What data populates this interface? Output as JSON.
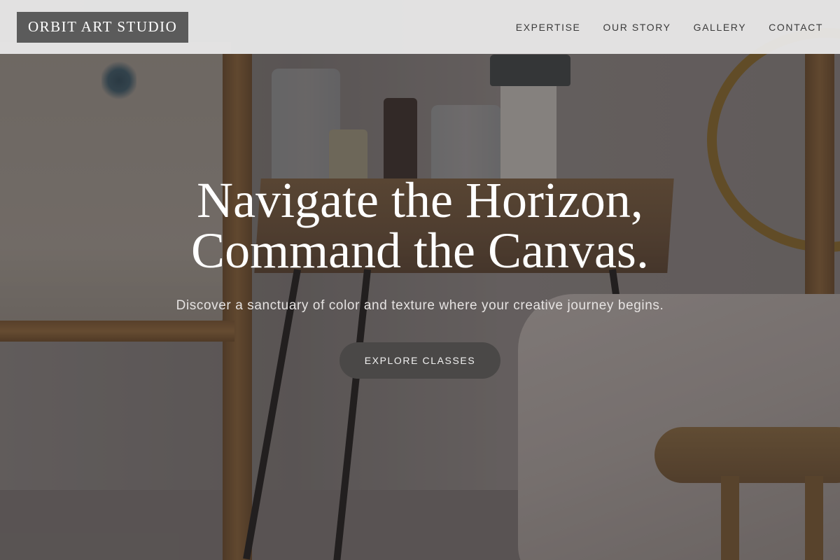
{
  "brand": {
    "name": "ORBIT ART STUDIO"
  },
  "nav": {
    "items": [
      {
        "label": "EXPERTISE"
      },
      {
        "label": "OUR STORY"
      },
      {
        "label": "GALLERY"
      },
      {
        "label": "CONTACT"
      }
    ]
  },
  "hero": {
    "headline_line1": "Navigate the Horizon,",
    "headline_line2": "Command the Canvas.",
    "subline": "Discover a sanctuary of color and texture where your creative journey begins.",
    "cta_label": "EXPLORE CLASSES"
  },
  "colors": {
    "nav_background": "#ececec",
    "logo_background": "#5b5b5b",
    "cta_background": "#4a4847",
    "headline_text": "#ffffff"
  }
}
